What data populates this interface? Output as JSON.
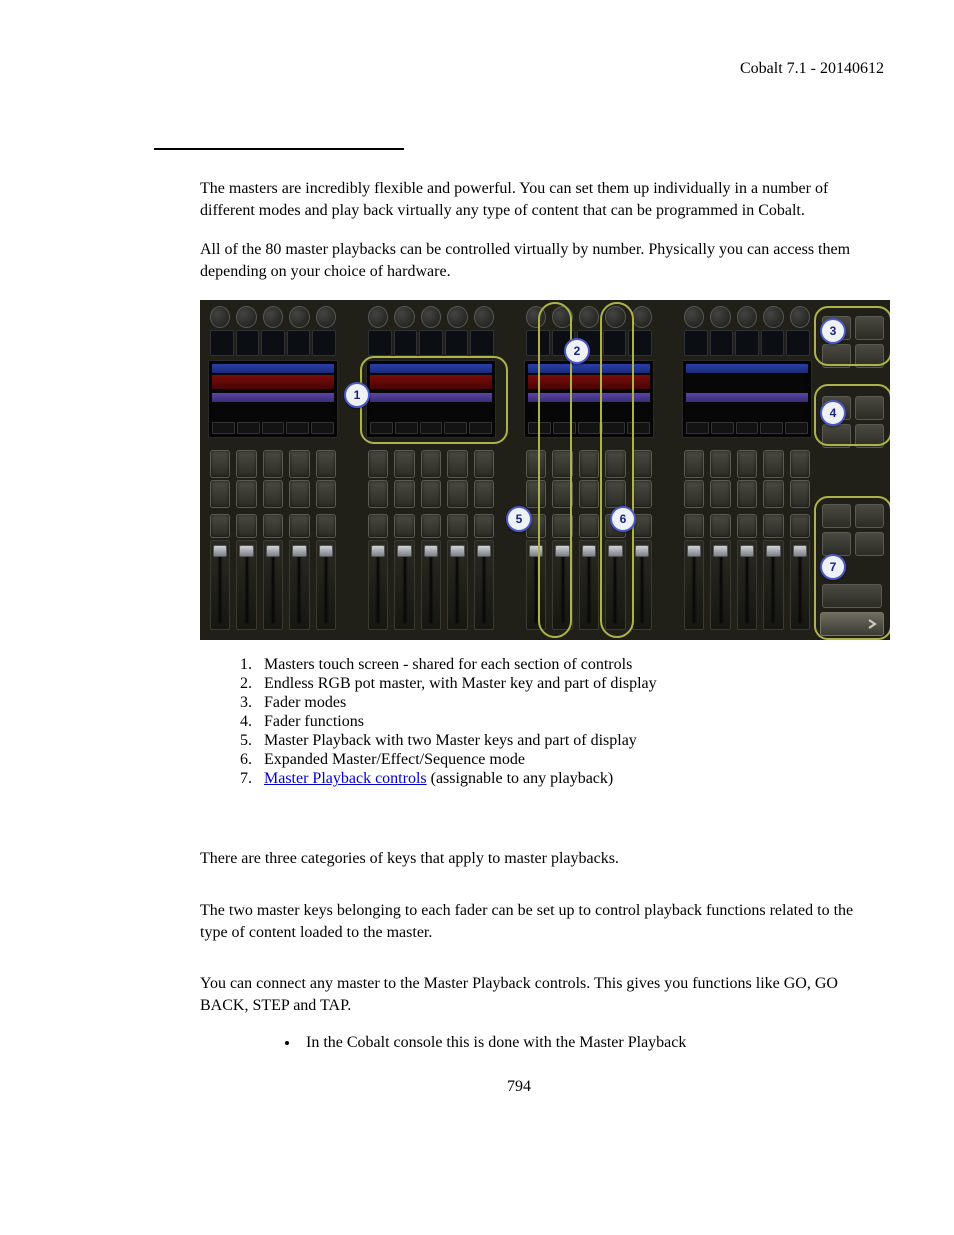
{
  "header": "Cobalt 7.1 - 20140612",
  "intro": {
    "p1": "The masters are incredibly flexible and powerful. You can set them up individually in a number of different modes and play back virtually any type of content that can be programmed in Cobalt.",
    "p2": "All of the 80 master playbacks can be controlled virtually by number. Physically you can access them depending on your choice of hardware."
  },
  "legend": {
    "i1": "Masters touch screen - shared for each section of controls",
    "i2": "Endless RGB pot master, with Master key and part of display",
    "i3": "Fader modes",
    "i4": "Fader functions",
    "i5": "Master Playback with two Master keys and part of display",
    "i6": "Expanded Master/Effect/Sequence mode",
    "i7_link": "Master Playback controls",
    "i7_tail": " (assignable to any playback)"
  },
  "body": {
    "p3": "There are three categories of keys that apply to master playbacks.",
    "p4": "The two master keys belonging to each fader can be set up to control playback functions related to the type of content loaded to the master.",
    "p5": "You can connect any master to the Master Playback controls. This gives you functions like GO, GO BACK, STEP and TAP.",
    "bullet1": "In the Cobalt console this is done with the Master Playback"
  },
  "callouts": {
    "c1": "1",
    "c2": "2",
    "c3": "3",
    "c4": "4",
    "c5": "5",
    "c6": "6",
    "c7": "7"
  },
  "page_number": "794"
}
